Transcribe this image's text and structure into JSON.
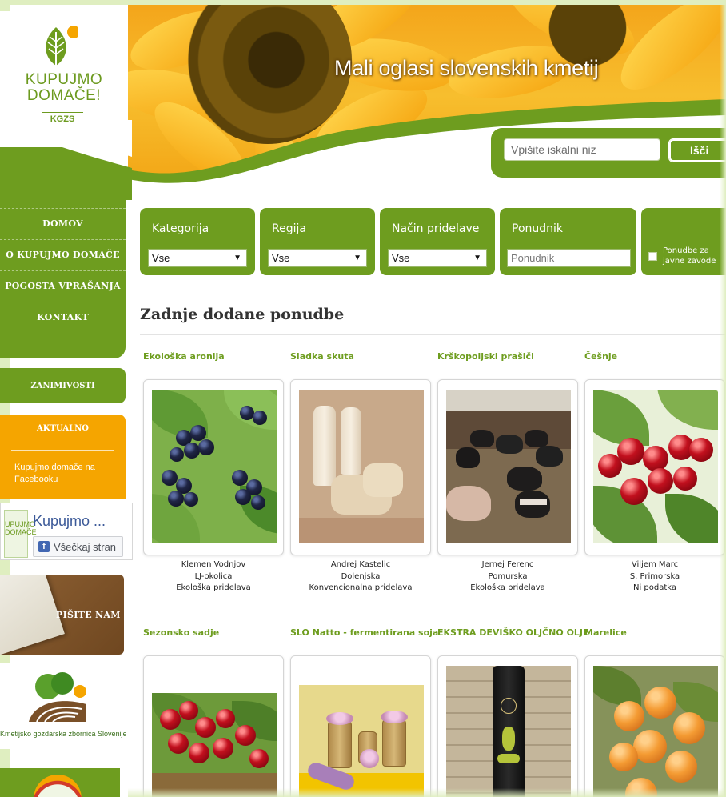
{
  "brand": {
    "logo_line1": "KUPUJMO",
    "logo_line2": "DOMAČE!",
    "logo_sub": "KGZS"
  },
  "header": {
    "title": "Mali oglasi slovenskih kmetij",
    "search_placeholder": "Vpišite iskalni niz",
    "search_button": "Išči"
  },
  "sidebar": {
    "nav": [
      {
        "label": "DOMOV"
      },
      {
        "label": "O KUPUJMO DOMAČE"
      },
      {
        "label": "POGOSTA VPRAŠANJA"
      },
      {
        "label": "KONTAKT"
      }
    ],
    "zanimivosti": "ZANIMIVOSTI",
    "aktualno_title": "AKTUALNO",
    "aktualno_link": "Kupujmo domače na Facebooku",
    "facebook": {
      "page_name": "Kupujmo ...",
      "like_button": "Všečkaj stran",
      "thumb_text": "UPUJMO DOMAČE"
    },
    "pisite_nam": "PIŠITE NAM",
    "kgzs_caption": "Kmetijsko gozdarska zbornica Slovenije"
  },
  "filters": {
    "kategorija": {
      "label": "Kategorija",
      "value": "Vse"
    },
    "regija": {
      "label": "Regija",
      "value": "Vse"
    },
    "nacin": {
      "label": "Način pridelave",
      "value": "Vse"
    },
    "ponudnik": {
      "label": "Ponudnik",
      "placeholder": "Ponudnik"
    },
    "javni_zavodi": {
      "label": "Ponudbe za javne zavode"
    }
  },
  "listing": {
    "title": "Zadnje dodane ponudbe",
    "row1": [
      {
        "title": "Ekološka aronija",
        "seller": "Klemen Vodnjov",
        "region": "LJ-okolica",
        "method": "Ekološka pridelava"
      },
      {
        "title": "Sladka skuta",
        "seller": "Andrej Kastelic",
        "region": "Dolenjska",
        "method": "Konvencionalna pridelava"
      },
      {
        "title": "Krškopoljski prašiči",
        "seller": "Jernej Ferenc",
        "region": "Pomurska",
        "method": "Ekološka pridelava"
      },
      {
        "title": "Češnje",
        "seller": "Viljem Marc",
        "region": "S. Primorska",
        "method": "Ni podatka"
      }
    ],
    "row2": [
      {
        "title": "Sezonsko sadje"
      },
      {
        "title": "SLO Natto - fermentirana soja"
      },
      {
        "title": "EKSTRA DEVIŠKO OLJČNO OLJE"
      },
      {
        "title": "Marelice"
      }
    ]
  },
  "colors": {
    "brand_green": "#6e9d1f",
    "accent_orange": "#f5a500",
    "brown": "#7a5028"
  }
}
